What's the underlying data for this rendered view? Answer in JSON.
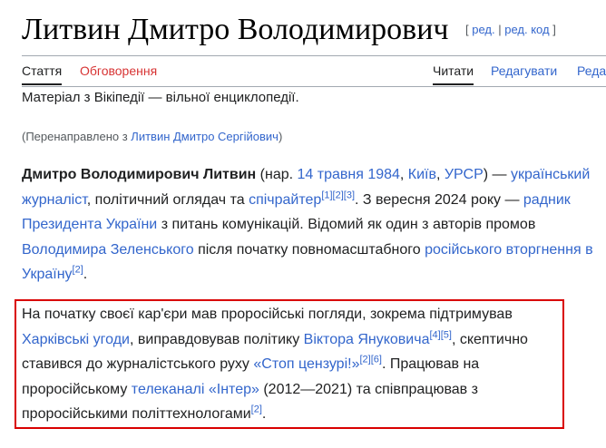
{
  "page": {
    "title": "Литвин Дмитро Володимирович",
    "edit_links": {
      "open": "[",
      "edit": "ред.",
      "sep": "|",
      "edit_source": "ред. код",
      "close": "]"
    }
  },
  "tabs": {
    "article": "Стаття",
    "talk": "Обговорення",
    "read": "Читати",
    "edit": "Редагувати",
    "edit_source": "Реда"
  },
  "from_wikipedia": "Матеріал з Вікіпедії — вільної енциклопедії.",
  "redirect": {
    "prefix": "(Перенаправлено з ",
    "link": "Литвин Дмитро Сергійович",
    "suffix": ")"
  },
  "paragraph1": {
    "name": "Дмитро Володимирович Литвин",
    "t1": " (нар. ",
    "birth_date": "14 травня 1984",
    "t2": ", ",
    "city": "Київ",
    "t3": ", ",
    "country": "УРСР",
    "t4": ") — ",
    "journalist": "український журналіст",
    "t5": ", політичний оглядач та ",
    "speechwriter": "спічрайтер",
    "ref1": "[1]",
    "ref2": "[2]",
    "ref3": "[3]",
    "t6": ". З вересня 2024 року — ",
    "adviser": "радник Президента України",
    "t7": " з питань комунікацій. Відомий як один з авторів промов ",
    "zelensky": "Володимира Зеленського",
    "t8": " після початку повномасштабного ",
    "invasion": "російського вторгнення в Україну",
    "ref4": "[2]",
    "t9": "."
  },
  "paragraph2": {
    "t1": "На початку своєї кар'єри мав проросійські погляди, зокрема підтримував ",
    "kharkiv": "Харківські угоди",
    "t2": ", виправдовував політику ",
    "yanukovych": "Віктора Януковича",
    "ref1": "[4]",
    "ref2": "[5]",
    "t3": ", скептично ставився до журналістського руху ",
    "stop": "«Стоп цензурі!»",
    "ref3": "[2]",
    "ref4": "[6]",
    "t4": ". Працював на проросійському ",
    "channel": "телеканалі «Інтер»",
    "t5": " (2012—2021) та співпрацював з проросійськими політтехнологами",
    "ref5": "[2]",
    "t6": "."
  }
}
